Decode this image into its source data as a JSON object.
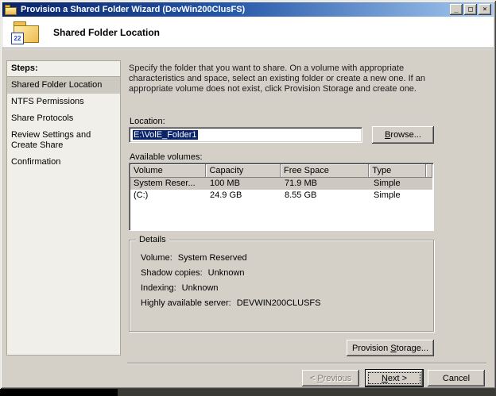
{
  "colors": {
    "titlebar_start": "#0a246a",
    "titlebar_end": "#a6caf0",
    "dialog_bg": "#d4d0c8",
    "selection": "#0a246a",
    "selected_row": "#cdc9c1"
  },
  "window": {
    "title": "Provision a Shared Folder Wizard (DevWin200ClusFS)",
    "controls": {
      "minimize": "_",
      "maximize": "□",
      "close": "×"
    }
  },
  "header": {
    "title": "Shared Folder Location",
    "icon_badge": "22"
  },
  "sidebar": {
    "heading": "Steps:",
    "items": [
      {
        "label": "Shared Folder Location",
        "selected": true
      },
      {
        "label": "NTFS Permissions",
        "selected": false
      },
      {
        "label": "Share Protocols",
        "selected": false
      },
      {
        "label": "Review Settings and Create Share",
        "selected": false
      },
      {
        "label": "Confirmation",
        "selected": false
      }
    ]
  },
  "main": {
    "description": "Specify the folder that you want to share. On a volume with appropriate characteristics and space, select an existing folder or create a new one. If an appropriate volume does not exist, click Provision Storage and create one.",
    "location": {
      "label": "Location:",
      "value": "E:\\VolE_Folder1",
      "browse_label": "Browse..."
    },
    "volumes": {
      "label": "Available volumes:",
      "columns": [
        "Volume",
        "Capacity",
        "Free Space",
        "Type"
      ],
      "rows": [
        {
          "cells": [
            "System Reser...",
            "100 MB",
            "71.9 MB",
            "Simple"
          ],
          "selected": true
        },
        {
          "cells": [
            "(C:)",
            "24.9 GB",
            "8.55 GB",
            "Simple"
          ],
          "selected": false
        }
      ]
    },
    "details": {
      "title": "Details",
      "fields": [
        {
          "label": "Volume:",
          "value": "System Reserved"
        },
        {
          "label": "Shadow copies:",
          "value": "Unknown"
        },
        {
          "label": "Indexing:",
          "value": "Unknown"
        },
        {
          "label": "Highly available server:",
          "value": "DEVWIN200CLUSFS"
        }
      ]
    },
    "provision_button": "Provision Storage..."
  },
  "footer": {
    "previous": "< Previous",
    "next": "Next >",
    "cancel": "Cancel"
  }
}
